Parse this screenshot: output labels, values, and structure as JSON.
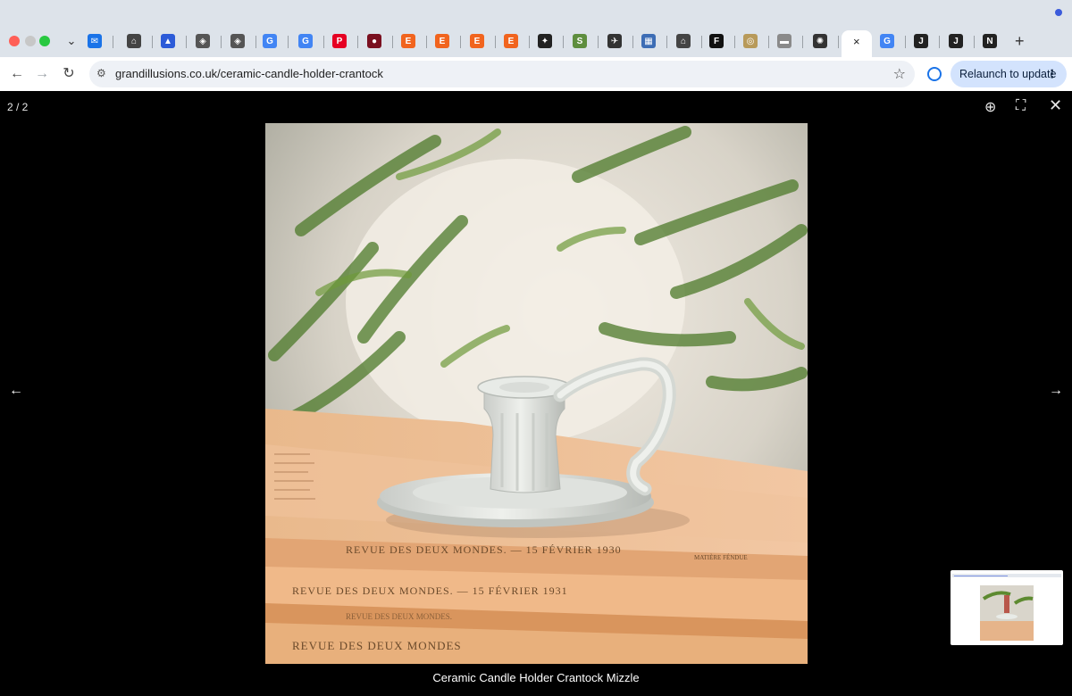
{
  "browser": {
    "url": "grandillusions.co.uk/ceramic-candle-holder-crantock",
    "relaunch_label": "Relaunch to update",
    "active_tab_close": "×",
    "new_tab_label": "+"
  },
  "viewer": {
    "counter": "2 / 2",
    "caption": "Ceramic Candle Holder Crantock Mizzle"
  },
  "photo_text": {
    "book1_spine": "REVUE DES DEUX MONDES. — 15 FÉVRIER 1930",
    "book1_tail": "MATIÈRE FÉNDUE",
    "book2_spine": "REVUE DES DEUX MONDES. — 15 FÉVRIER 1931",
    "book3_spine": "REVUE DES DEUX MONDES.",
    "book4_spine": "REVUE DES DEUX MONDES"
  },
  "pinned_tabs": [
    {
      "icon": "mail-icon",
      "color": "#1a73e8",
      "glyph": "✉"
    },
    {
      "icon": "home-icon",
      "color": "#444444",
      "glyph": "⌂"
    },
    {
      "icon": "graduation-cap-icon",
      "color": "#2c5bd8",
      "glyph": "▲"
    },
    {
      "icon": "crest-icon",
      "color": "#555555",
      "glyph": "◈"
    },
    {
      "icon": "crest-icon",
      "color": "#555555",
      "glyph": "◈"
    },
    {
      "icon": "google-icon",
      "color": "#4285f4",
      "glyph": "G"
    },
    {
      "icon": "google-icon",
      "color": "#4285f4",
      "glyph": "G"
    },
    {
      "icon": "pinterest-icon",
      "color": "#e60023",
      "glyph": "P"
    },
    {
      "icon": "rose-icon",
      "color": "#7a1020",
      "glyph": "●"
    },
    {
      "icon": "etsy-icon",
      "color": "#f1641e",
      "glyph": "E"
    },
    {
      "icon": "etsy-icon",
      "color": "#f1641e",
      "glyph": "E"
    },
    {
      "icon": "etsy-icon",
      "color": "#f1641e",
      "glyph": "E"
    },
    {
      "icon": "etsy-icon",
      "color": "#f1641e",
      "glyph": "E"
    },
    {
      "icon": "puzzle-icon",
      "color": "#222222",
      "glyph": "✦"
    },
    {
      "icon": "shopify-icon",
      "color": "#5e8e3e",
      "glyph": "S"
    },
    {
      "icon": "bird-icon",
      "color": "#333333",
      "glyph": "✈"
    },
    {
      "icon": "building-icon",
      "color": "#3d6db5",
      "glyph": "▦"
    },
    {
      "icon": "home-icon",
      "color": "#444444",
      "glyph": "⌂"
    },
    {
      "icon": "f-logo-icon",
      "color": "#111111",
      "glyph": "F"
    },
    {
      "icon": "badge-icon",
      "color": "#b89a5a",
      "glyph": "◎"
    },
    {
      "icon": "gray-box-icon",
      "color": "#8a8a8a",
      "glyph": "▬"
    },
    {
      "icon": "openai-icon",
      "color": "#333333",
      "glyph": "✺"
    },
    {
      "icon": "google-icon",
      "color": "#4285f4",
      "glyph": "G"
    },
    {
      "icon": "j-icon",
      "color": "#222222",
      "glyph": "J"
    },
    {
      "icon": "j-icon",
      "color": "#222222",
      "glyph": "J"
    },
    {
      "icon": "nova-icon",
      "color": "#222222",
      "glyph": "N"
    }
  ]
}
